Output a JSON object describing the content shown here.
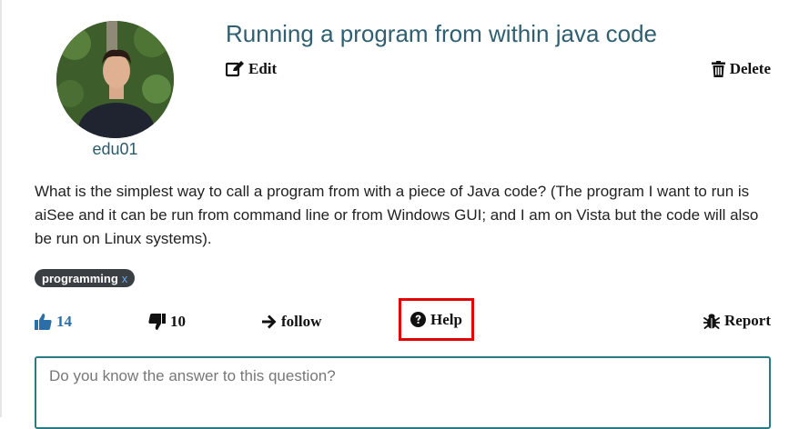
{
  "question": {
    "title": "Running a program from within java code",
    "author": "edu01",
    "body": "What is the simplest way to call a program from with a piece of Java code? (The program I want to run is aiSee and it can be run from command line or from Windows GUI; and I am on Vista but the code will also be run on Linux systems).",
    "tags": [
      {
        "label": "programming",
        "remove": "x"
      }
    ]
  },
  "actions": {
    "edit_label": "Edit",
    "delete_label": "Delete",
    "upvotes": "14",
    "downvotes": "10",
    "follow_label": "follow",
    "help_label": "Help",
    "report_label": "Report"
  },
  "answer": {
    "placeholder": "Do you know the answer to this question?"
  },
  "colors": {
    "title": "#2f5f70",
    "upvote": "#2b6fa8",
    "tag_bg": "#3a3f44",
    "help_highlight": "#e00000",
    "answer_border": "#2a7a85"
  },
  "icons": {
    "edit": "edit-icon",
    "delete": "trash-icon",
    "upvote": "thumbs-up-icon",
    "downvote": "thumbs-down-icon",
    "follow": "arrow-right-icon",
    "help": "question-circle-icon",
    "report": "bug-icon"
  }
}
